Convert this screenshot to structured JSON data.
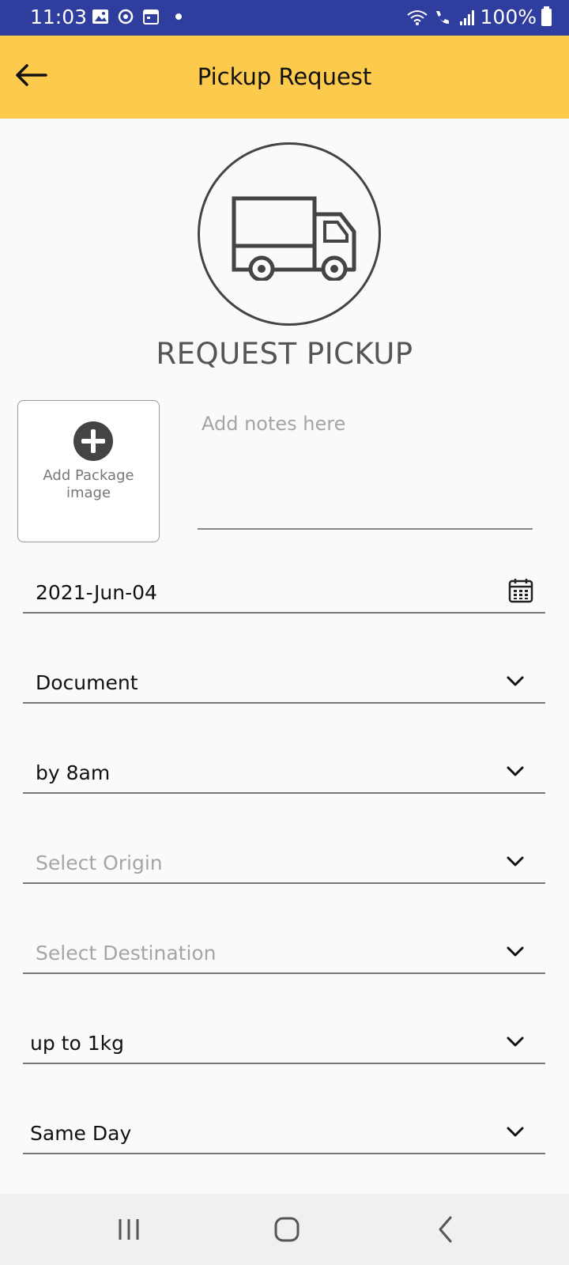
{
  "status_bar": {
    "time": "11:03",
    "battery": "100%",
    "icons": [
      "gallery-icon",
      "sync-icon",
      "calendar-icon",
      "wifi-icon",
      "wifi-call-icon",
      "signal-icon",
      "battery-icon"
    ]
  },
  "app_bar": {
    "title": "Pickup Request",
    "back_icon": "arrow-left-icon"
  },
  "hero": {
    "icon": "truck-icon",
    "heading": "REQUEST PICKUP"
  },
  "package": {
    "add_label": "Add Package image",
    "icon": "add-circle-icon"
  },
  "notes": {
    "placeholder": "Add notes here",
    "value": ""
  },
  "form": {
    "date": "2021-Jun-04",
    "item_type": "Document",
    "time_window": "by 8am",
    "origin_placeholder": "Select Origin",
    "destination_placeholder": "Select Destination",
    "weight": "up to 1kg",
    "service": "Same Day"
  },
  "colors": {
    "status_bar": "#2f3e9e",
    "app_bar": "#fccb4d",
    "background": "#fafafa"
  }
}
